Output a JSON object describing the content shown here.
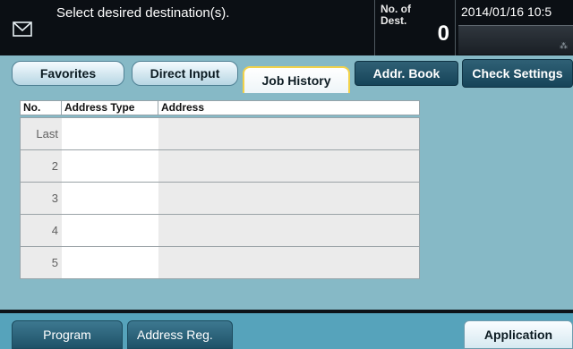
{
  "header": {
    "prompt": "Select desired destination(s).",
    "dest_label_line1": "No. of",
    "dest_label_line2": "Dest.",
    "dest_count": "0",
    "datetime": "2014/01/16 10:5"
  },
  "tabs": [
    {
      "label": "Favorites",
      "state": "inactive"
    },
    {
      "label": "Direct Input",
      "state": "inactive"
    },
    {
      "label": "Job History",
      "state": "selected"
    },
    {
      "label": "Addr. Book",
      "state": "inactive"
    },
    {
      "label": "Check Settings",
      "state": "inactive"
    }
  ],
  "table": {
    "columns": [
      "No.",
      "Address Type",
      "Address"
    ],
    "rows": [
      {
        "no": "Last",
        "type": "",
        "address": ""
      },
      {
        "no": "2",
        "type": "",
        "address": ""
      },
      {
        "no": "3",
        "type": "",
        "address": ""
      },
      {
        "no": "4",
        "type": "",
        "address": ""
      },
      {
        "no": "5",
        "type": "",
        "address": ""
      }
    ]
  },
  "bottom": {
    "program": "Program",
    "address_reg": "Address Reg.",
    "application": "Application"
  },
  "icons": {
    "destination": "envelope-icon",
    "status": "status-indicator-icon"
  },
  "colors": {
    "header_bg": "#0b0f14",
    "content_bg": "#86b9c6",
    "active_tab_border": "#f2d24a",
    "dark_tab": "#1f5268",
    "bottom_bar": "#56a3bb"
  }
}
